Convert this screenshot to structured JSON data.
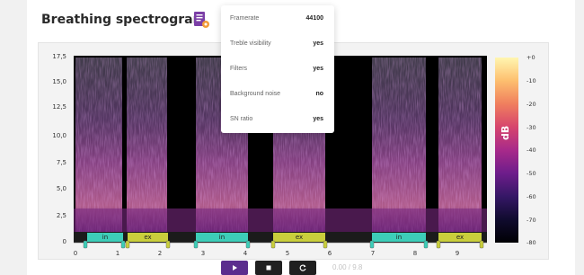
{
  "header": {
    "title": "Breathing spectrogram",
    "settings_icon": "document-settings-icon"
  },
  "y_axis": {
    "ticks": [
      "17,5",
      "15,0",
      "12,5",
      "10,0",
      "7,5",
      "5,0",
      "2,5",
      "0"
    ]
  },
  "x_axis": {
    "ticks": [
      "0",
      "1",
      "2",
      "3",
      "4",
      "5",
      "6",
      "7",
      "8",
      "9"
    ]
  },
  "colorbar": {
    "unit": "dB",
    "ticks": [
      "+0",
      "-10",
      "-20",
      "-30",
      "-40",
      "-50",
      "-60",
      "-70",
      "-80"
    ],
    "colors": [
      "#fff6b0",
      "#fdbf6f",
      "#f07f5e",
      "#d6456d",
      "#a82a8a",
      "#6e1d8b",
      "#351766",
      "#100b2e",
      "#000004"
    ]
  },
  "segments": [
    {
      "label": "in",
      "kind": "in"
    },
    {
      "label": "ex",
      "kind": "ex"
    },
    {
      "label": "in",
      "kind": "in"
    },
    {
      "label": "ex",
      "kind": "ex"
    },
    {
      "label": "in",
      "kind": "in"
    },
    {
      "label": "ex",
      "kind": "ex"
    }
  ],
  "segment_colors": {
    "in": "#3dcdb8",
    "ex": "#c9ce3c"
  },
  "settings_popover": {
    "rows": [
      {
        "key": "Framerate",
        "value": "44100"
      },
      {
        "key": "Treble visibility",
        "value": "yes"
      },
      {
        "key": "Filters",
        "value": "yes"
      },
      {
        "key": "Background noise",
        "value": "no"
      },
      {
        "key": "SN ratio",
        "value": "yes"
      }
    ]
  },
  "controls": {
    "play_icon": "play-icon",
    "stop_icon": "stop-icon",
    "loop_icon": "loop-icon",
    "time": "0.00 / 9.8",
    "accent": "#5b2d8e"
  }
}
